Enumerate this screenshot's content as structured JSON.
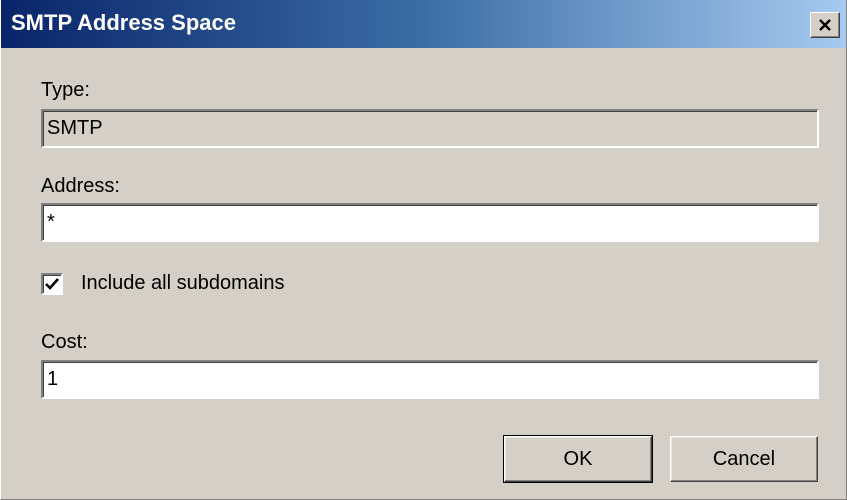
{
  "window": {
    "title": "SMTP Address Space",
    "close_icon": "close-icon"
  },
  "form": {
    "type_label": "Type:",
    "type_value": "SMTP",
    "address_label": "Address:",
    "address_value": "*",
    "include_subdomains_label": "Include all subdomains",
    "include_subdomains_checked": true,
    "cost_label": "Cost:",
    "cost_value": "1"
  },
  "buttons": {
    "ok_label": "OK",
    "cancel_label": "Cancel"
  },
  "colors": {
    "dialog_background": "#d4d0c8",
    "titlebar_start": "#0a246a",
    "titlebar_end": "#a6caf0"
  }
}
